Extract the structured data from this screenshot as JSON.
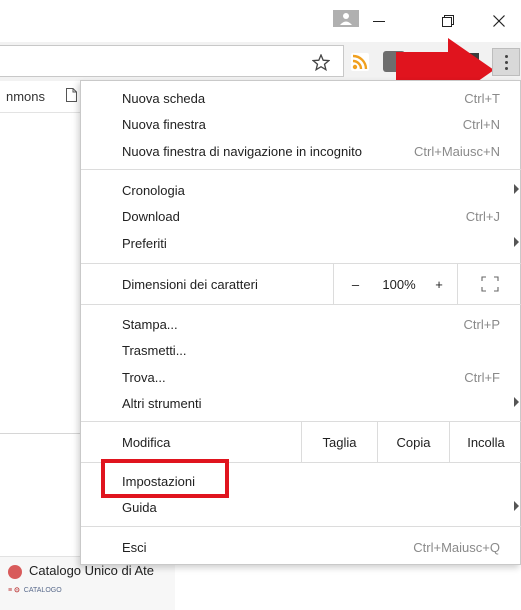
{
  "window": {
    "minimize_icon": "minimize-icon",
    "maximize_icon": "restore-icon",
    "close_icon": "close-icon",
    "profile_icon": "profile-icon"
  },
  "toolbar": {
    "bookmark_icon": "star-icon",
    "menu_icon": "three-dots-vertical-icon"
  },
  "page": {
    "bookmark_label": "nmons",
    "tab_title": "Catalogo Unico di Ate",
    "thumb_text": "CATALOGO"
  },
  "menu": {
    "group1": [
      {
        "label": "Nuova scheda",
        "shortcut": "Ctrl+T"
      },
      {
        "label": "Nuova finestra",
        "shortcut": "Ctrl+N"
      },
      {
        "label": "Nuova finestra di navigazione in incognito",
        "shortcut": "Ctrl+Maiusc+N"
      }
    ],
    "group2": [
      {
        "label": "Cronologia",
        "shortcut": ""
      },
      {
        "label": "Download",
        "shortcut": "Ctrl+J"
      },
      {
        "label": "Preferiti",
        "shortcut": ""
      }
    ],
    "zoom": {
      "label": "Dimensioni dei caratteri",
      "minus": "–",
      "value": "100%",
      "plus": "+",
      "fullscreen_icon": "fullscreen-icon"
    },
    "group3": [
      {
        "label": "Stampa...",
        "shortcut": "Ctrl+P"
      },
      {
        "label": "Trasmetti...",
        "shortcut": ""
      },
      {
        "label": "Trova...",
        "shortcut": "Ctrl+F"
      },
      {
        "label": "Altri strumenti",
        "shortcut": ""
      }
    ],
    "edit": {
      "label": "Modifica",
      "cut": "Taglia",
      "copy": "Copia",
      "paste": "Incolla"
    },
    "group4": [
      {
        "label": "Impostazioni",
        "shortcut": ""
      },
      {
        "label": "Guida",
        "shortcut": ""
      }
    ],
    "group5": [
      {
        "label": "Esci",
        "shortcut": "Ctrl+Maiusc+Q"
      }
    ]
  },
  "annotation": {
    "arrow_color": "#e0141e",
    "highlight_color": "#e0141e"
  }
}
